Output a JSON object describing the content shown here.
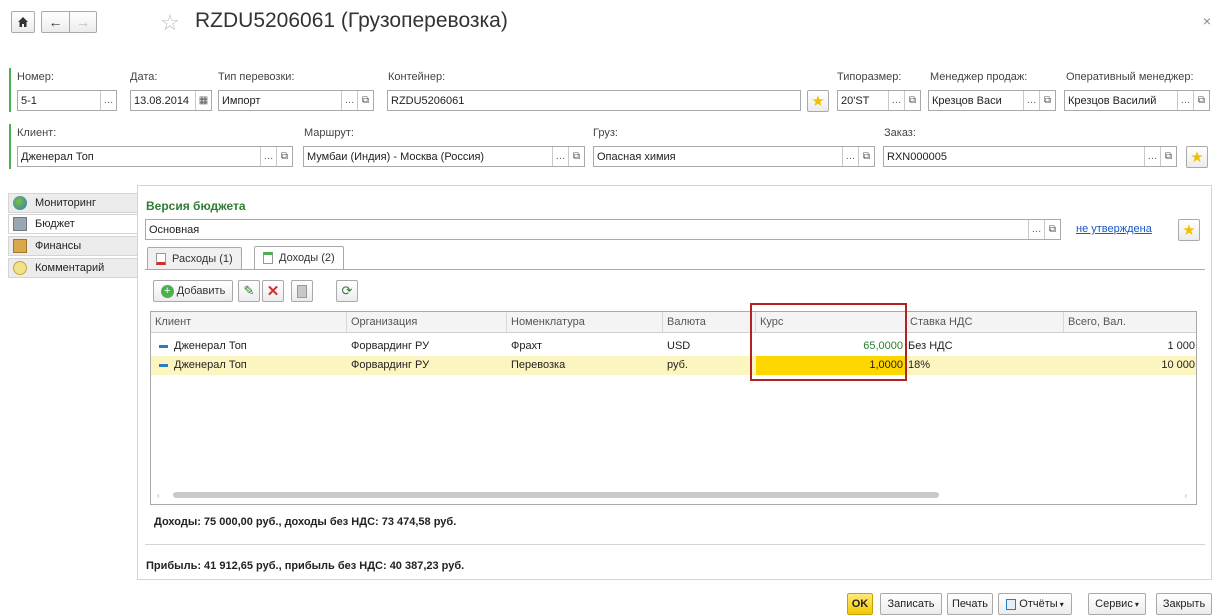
{
  "header": {
    "title": "RZDU5206061 (Грузоперевозка)",
    "close": "×"
  },
  "form": {
    "nomer": {
      "label": "Номер:",
      "value": "5-1"
    },
    "data": {
      "label": "Дата:",
      "value": "13.08.2014"
    },
    "tip": {
      "label": "Тип перевозки:",
      "value": "Импорт"
    },
    "konteiner": {
      "label": "Контейнер:",
      "value": "RZDU5206061"
    },
    "tiporazmer": {
      "label": "Типоразмер:",
      "value": "20'ST"
    },
    "manager": {
      "label": "Менеджер продаж:",
      "value": "Крезцов Васи"
    },
    "oper_manager": {
      "label": "Оперативный менеджер:",
      "value": "Крезцов Василий"
    },
    "klient": {
      "label": "Клиент:",
      "value": "Дженерал Топ"
    },
    "marshrut": {
      "label": "Маршрут:",
      "value": "Мумбаи (Индия) - Москва (Россия)"
    },
    "gruz": {
      "label": "Груз:",
      "value": "Опасная химия"
    },
    "zakaz": {
      "label": "Заказ:",
      "value": "RXN000005"
    }
  },
  "nav": [
    {
      "label": "Мониторинг",
      "icon": "globe-icon"
    },
    {
      "label": "Бюджет",
      "icon": "calculator-icon"
    },
    {
      "label": "Финансы",
      "icon": "finance-icon"
    },
    {
      "label": "Комментарий",
      "icon": "comment-icon"
    }
  ],
  "budget": {
    "heading": "Версия бюджета",
    "version": "Основная",
    "status_link": "не утверждена"
  },
  "tabs": [
    {
      "label": "Расходы (1)"
    },
    {
      "label": "Доходы (2)"
    }
  ],
  "toolbar": {
    "add_label": "Добавить"
  },
  "grid": {
    "columns": [
      "Клиент",
      "Организация",
      "Номенклатура",
      "Валюта",
      "Курс",
      "Ставка НДС",
      "Всего, Вал."
    ],
    "rows": [
      [
        "Дженерал Топ",
        "Форвардинг РУ",
        "Фрахт",
        "USD",
        "65,0000",
        "Без НДС",
        "1 000"
      ],
      [
        "Дженерал Топ",
        "Форвардинг РУ",
        "Перевозка",
        "руб.",
        "1,0000",
        "18%",
        "10 000"
      ]
    ]
  },
  "summary": {
    "income": "Доходы: 75 000,00 руб., доходы без НДС: 73 474,58 руб.",
    "profit": "Прибыль: 41 912,65 руб., прибыль без НДС: 40 387,23 руб."
  },
  "buttons": {
    "ok": "OK",
    "save": "Записать",
    "print": "Печать",
    "reports": "Отчёты",
    "service": "Сервис",
    "close": "Закрыть"
  },
  "colors": {
    "accent_green": "#4caf50",
    "highlight_yellow": "#fdf5c0",
    "selected_cell": "#ffd700",
    "annotation_red": "#b22222"
  }
}
